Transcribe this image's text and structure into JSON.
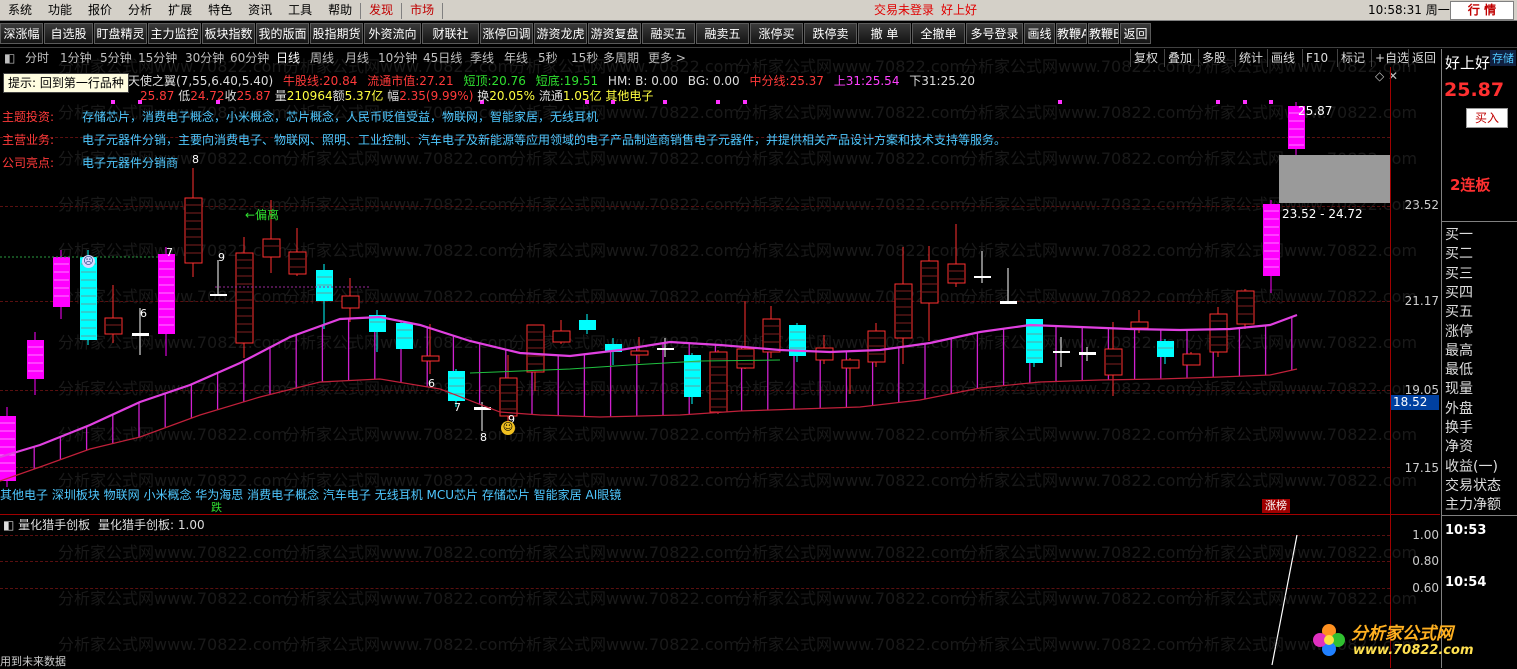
{
  "menu": {
    "items": [
      "系统",
      "功能",
      "报价",
      "分析",
      "扩展",
      "特色",
      "资讯",
      "工具",
      "帮助"
    ],
    "discover": "发现",
    "market": "市场",
    "login_status": "交易未登录",
    "brand": "好上好",
    "clock": "10:58:31 周一",
    "trade_button": "行 情"
  },
  "toolbar": {
    "buttons": [
      "深涨幅",
      "自选股",
      "盯盘精灵",
      "主力监控",
      "板块指数",
      "我的版面",
      "股指期货",
      "外资流向",
      "财联社",
      "涨停回调",
      "游资龙虎",
      "游资复盘",
      "融买五",
      "融卖五",
      "涨停买",
      "跌停卖",
      "撤 单",
      "全撤单",
      "多号登录",
      "画线",
      "教鞭A",
      "教鞭B",
      "返回"
    ]
  },
  "periods": {
    "items": [
      "分时",
      "1分钟",
      "5分钟",
      "15分钟",
      "30分钟",
      "60分钟",
      "日线",
      "周线",
      "月线",
      "10分钟",
      "45日线",
      "季线",
      "年线",
      "5秒",
      "15秒",
      "多周期",
      "更多 >"
    ],
    "active": "日线",
    "right_buttons": [
      "复权",
      "叠加",
      "多股",
      "统计",
      "画线",
      "F10",
      "标记",
      "+自选",
      "返回"
    ]
  },
  "tooltip": {
    "label": "提示:",
    "text": "回到第一行品种"
  },
  "indicator_line": {
    "name": "天使之翼(7,55,6.40,5.40)",
    "bull_label": "牛股线:",
    "bull": "20.84",
    "float_mv_label": "流通市值:",
    "float_mv": "27.21",
    "short_top_label": "短顶:",
    "short_top": "20.76",
    "short_bottom_label": "短底:",
    "short_bottom": "19.51",
    "hm": "HM: B: 0.00",
    "bg": "BG: 0.00",
    "mid_label": "中分线:",
    "mid": "25.37",
    "up31_label": "上31:",
    "up31": "25.54",
    "down31_label": "下31:",
    "down31": "25.20"
  },
  "ohlc_line": {
    "high": "25.87",
    "low_label": "低",
    "low": "24.72",
    "close_label": "收",
    "close": "25.87",
    "vol_label": "量",
    "vol": "210964",
    "amount_label": "额",
    "amount": "5.37亿",
    "range_label": "幅",
    "range": "2.35(9.99%)",
    "turnover_label": "换",
    "turnover": "20.05%",
    "float_label": "流通",
    "float": "1.05亿",
    "sector": "其他电子"
  },
  "company": {
    "theme_label": "主题投资:",
    "theme": "存储芯片，消费电子概念，小米概念，芯片概念，人民币贬值受益，物联网，智能家居，无线耳机",
    "business_label": "主营业务:",
    "business": "电子元器件分销，主要向消费电子、物联网、照明、工业控制、汽车电子及新能源等应用领域的电子产品制造商销售电子元器件，并提供相关产品设计方案和技术支持等服务。",
    "highlight_label": "公司亮点:",
    "highlight": "电子元器件分销商"
  },
  "price_axis": {
    "labels": [
      "23.52",
      "21.17",
      "19.05",
      "17.15"
    ],
    "current_tag": "18.52"
  },
  "annotations": {
    "peak_label": "25.87",
    "band_label": "23.52 - 24.72",
    "deviation_label": "←偏离",
    "digits": [
      "8",
      "7",
      "9",
      "6",
      "6",
      "7",
      "8",
      "9"
    ]
  },
  "concept_line": "其他电子  深圳板块  物联网  小米概念  华为海思  消费电子概念  汽车电子  无线耳机  MCU芯片  存储芯片  智能家居  AI眼镜",
  "bottom_markers": {
    "fall": "跌",
    "limit_list": "涨榜"
  },
  "sub_indicator": {
    "name": "量化猎手创板",
    "value_label": "量化猎手创板:",
    "value": "1.00",
    "axis": [
      "1.00",
      "0.80",
      "0.60"
    ]
  },
  "status_text": "用到未来数据",
  "right_panel": {
    "name": "好上好",
    "name_tag": "存储",
    "price": "25.87",
    "buy_button": "买入",
    "streak": "2连板",
    "rows": [
      "买一",
      "买二",
      "买三",
      "买四",
      "买五",
      "涨停",
      "最高",
      "最低",
      "现量",
      "外盘",
      "换手",
      "净资",
      "收益(一)",
      "交易状态",
      "主力净额"
    ],
    "times": [
      "10:53",
      "10:54"
    ]
  },
  "watermark": {
    "text": "分析家公式网www.70822.com",
    "logo_name": "分析家公式网",
    "logo_url": "www.70822.com"
  },
  "colors": {
    "up": "#ff00ff",
    "down": "#00ffff",
    "ma_line": "#e040e0",
    "band_line": "#c0203a",
    "positive_text": "#ff3333"
  }
}
